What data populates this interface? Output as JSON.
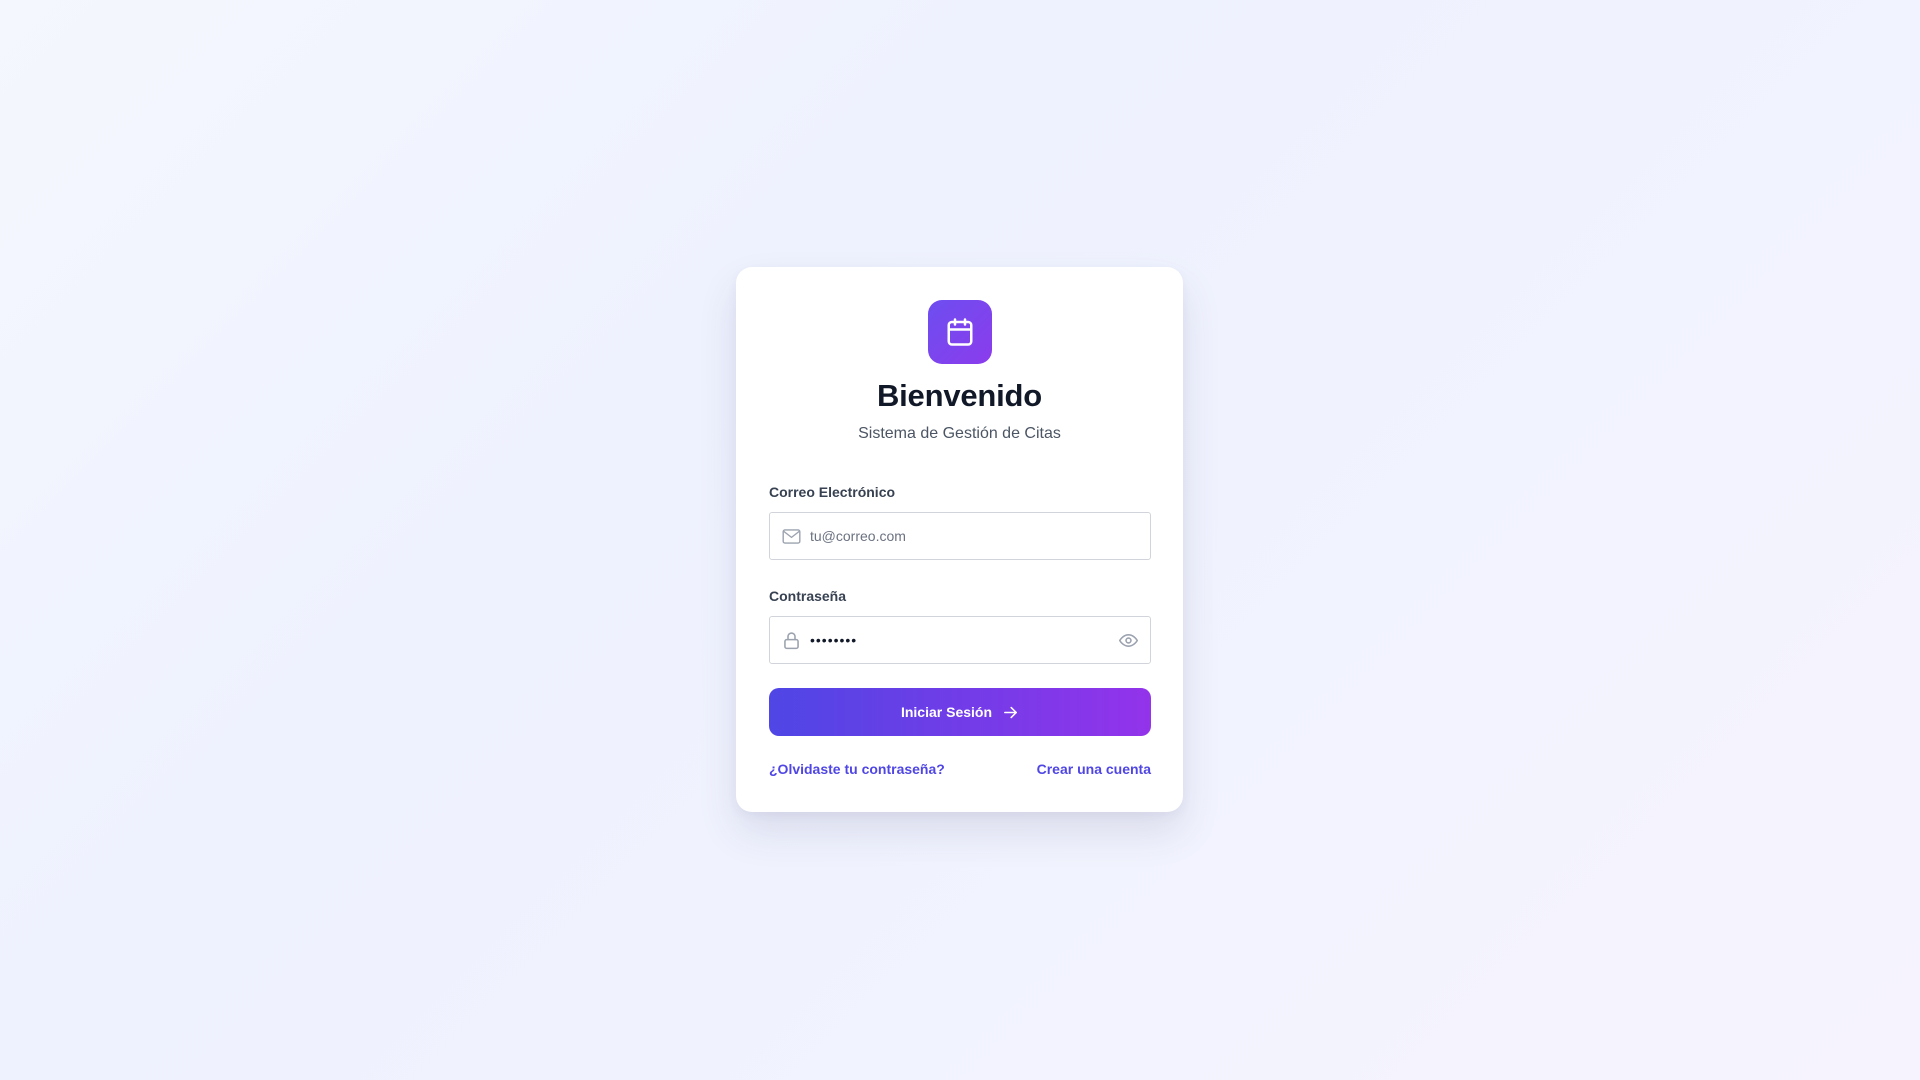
{
  "login": {
    "logo_icon": "calendar-icon",
    "title": "Bienvenido",
    "subtitle": "Sistema de Gestión de Citas",
    "email": {
      "label": "Correo Electrónico",
      "placeholder": "tu@correo.com",
      "value": "",
      "icon": "mail-icon"
    },
    "password": {
      "label": "Contraseña",
      "value": "••••••••",
      "icon": "lock-icon",
      "toggle_icon": "eye-icon"
    },
    "submit_label": "Iniciar Sesión",
    "submit_icon": "arrow-right-icon",
    "forgot_link": "¿Olvidaste tu contraseña?",
    "create_link": "Crear una cuenta"
  },
  "colors": {
    "accent": "#4f46e5",
    "accent_end": "#9333ea",
    "logo_start": "#6d4ef0",
    "logo_end": "#8b3cec",
    "title": "#111827",
    "subtitle": "#4b5563",
    "border": "#d1d5db"
  }
}
